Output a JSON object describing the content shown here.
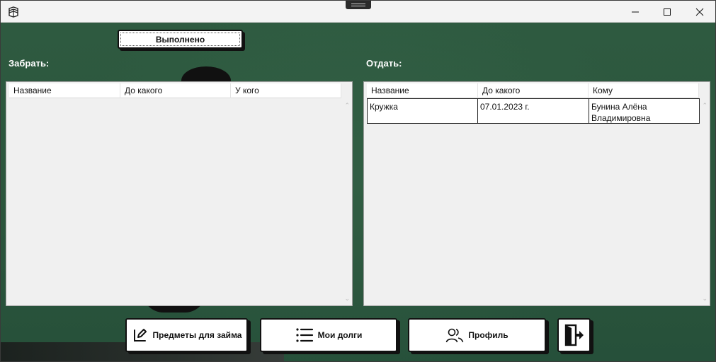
{
  "window": {
    "icons": {
      "app": "book-icon",
      "minimize": "minimize-icon",
      "maximize": "maximize-icon",
      "close": "close-icon"
    }
  },
  "top_button": {
    "label": "Выполнено"
  },
  "take": {
    "label": "Забрать:",
    "columns": [
      "Название",
      "До какого",
      "У кого"
    ],
    "rows": []
  },
  "give": {
    "label": "Отдать:",
    "columns": [
      "Название",
      "До какого",
      "Кому"
    ],
    "rows": [
      {
        "name": "Кружка",
        "until": "07.01.2023 г.",
        "to": "Бунина Алёна Владимировна"
      }
    ]
  },
  "nav": {
    "loans": {
      "label": "Предметы для займа",
      "icon": "edit-item-icon"
    },
    "debts": {
      "label": "Мои долги",
      "icon": "list-icon"
    },
    "profile": {
      "label": "Профиль",
      "icon": "users-icon"
    },
    "exit": {
      "icon": "exit-door-icon"
    }
  }
}
